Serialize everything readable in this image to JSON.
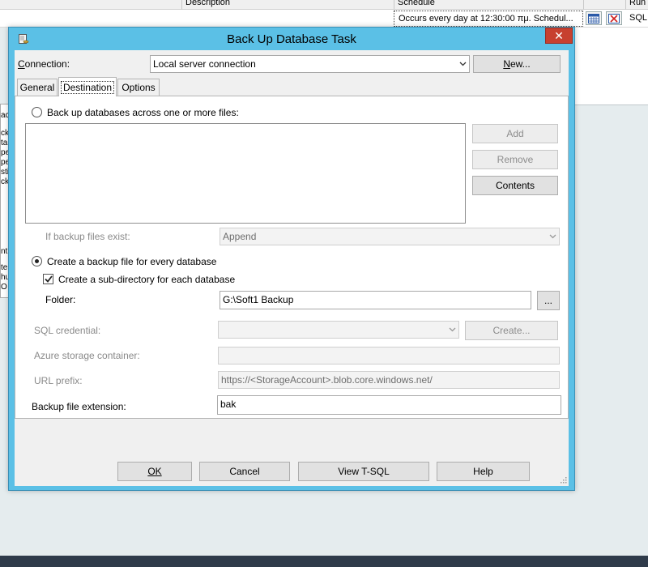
{
  "background": {
    "grid_headers": [
      "Description",
      "Schedule",
      "Run a"
    ],
    "schedule_cell": "Occurs every day at 12:30:00 πμ. Schedul...",
    "sql_text": "SQL",
    "left_panel_fragments": [
      "ac",
      "ck",
      "ta",
      "pe",
      "pe",
      "sti",
      "ck",
      "nt",
      "ter",
      "hu",
      "O"
    ]
  },
  "dialog": {
    "title": "Back Up Database Task",
    "close_label": "✕",
    "connection": {
      "label_pre": "C",
      "label_post": "onnection:",
      "value": "Local server connection",
      "new_button_pre": "",
      "new_button_u": "N",
      "new_button_post": "ew..."
    },
    "tabs": [
      "General",
      "Destination",
      "Options"
    ],
    "destination": {
      "radio_across_files": "Back up databases across one or more files:",
      "add_button": "Add",
      "remove_button": "Remove",
      "contents_button": "Contents",
      "if_exists_label": "If backup files exist:",
      "if_exists_value": "Append",
      "radio_every_db": "Create a backup file for every database",
      "subdir_checkbox": "Create a sub-directory for each database",
      "folder_label": "Folder:",
      "folder_value": "G:\\Soft1 Backup",
      "folder_browse": "...",
      "sql_credential_label": "SQL credential:",
      "create_button": "Create...",
      "azure_container_label": "Azure storage container:",
      "url_prefix_label": "URL prefix:",
      "url_prefix_value": "https://<StorageAccount>.blob.core.windows.net/",
      "extension_label": "Backup file extension:",
      "extension_value": "bak"
    },
    "buttons": {
      "ok": "OK",
      "cancel": "Cancel",
      "view_tsql": "View T-SQL",
      "help": "Help"
    }
  },
  "colors": {
    "title_bar": "#5bc0e6",
    "close_button": "#c7402f",
    "dialog_face": "#f0f0f0"
  }
}
